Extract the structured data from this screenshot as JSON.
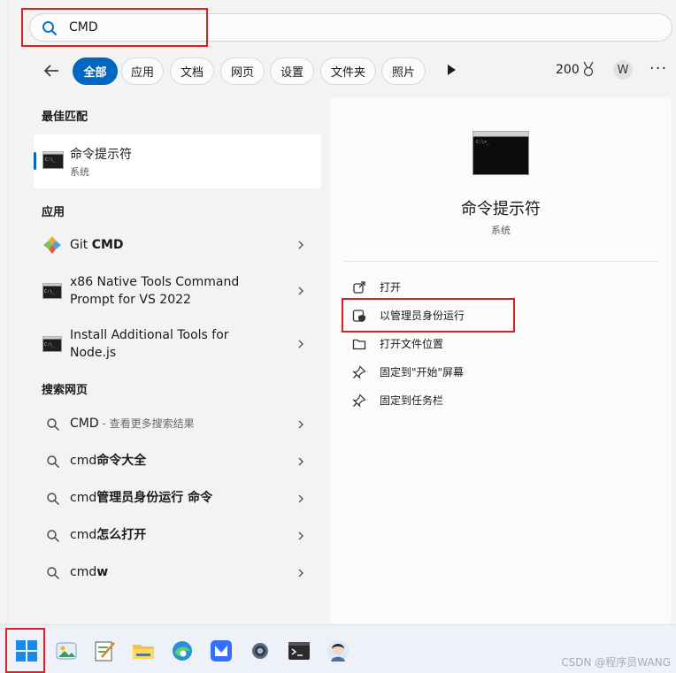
{
  "search": {
    "value": "CMD"
  },
  "filters": {
    "tabs": [
      {
        "label": "全部",
        "active": true
      },
      {
        "label": "应用"
      },
      {
        "label": "文档"
      },
      {
        "label": "网页"
      },
      {
        "label": "设置"
      },
      {
        "label": "文件夹"
      },
      {
        "label": "照片"
      }
    ],
    "points": "200",
    "avatar_initial": "W",
    "more": "···"
  },
  "best_match": {
    "heading": "最佳匹配",
    "name": "命令提示符",
    "sub": "系统",
    "icon": "terminal-icon"
  },
  "apps": {
    "heading": "应用",
    "items": [
      {
        "prefix": "Git ",
        "bold": "CMD",
        "icon": "git-icon"
      },
      {
        "line1": "x86 Native Tools Command",
        "line2": "Prompt for VS 2022",
        "icon": "terminal-icon"
      },
      {
        "line1": "Install Additional Tools for",
        "line2": "Node.js",
        "icon": "terminal-icon"
      }
    ]
  },
  "web": {
    "heading": "搜索网页",
    "items": [
      {
        "main": "CMD",
        "suffix": " - 查看更多搜索结果"
      },
      {
        "main": "cmd",
        "bold": "命令大全"
      },
      {
        "main": "cmd",
        "bold": "管理员身份运行 命令"
      },
      {
        "main": "cmd",
        "bold": "怎么打开"
      },
      {
        "main": "cmd",
        "bold": "w"
      }
    ]
  },
  "detail": {
    "title": "命令提示符",
    "sub": "系统",
    "actions": [
      {
        "label": "打开",
        "icon": "open-external-icon"
      },
      {
        "label": "以管理员身份运行",
        "icon": "shield-icon"
      },
      {
        "label": "打开文件位置",
        "icon": "folder-icon"
      },
      {
        "label": "固定到\"开始\"屏幕",
        "icon": "pin-icon"
      },
      {
        "label": "固定到任务栏",
        "icon": "pin-icon"
      }
    ]
  },
  "taskbar": {
    "icons": [
      "start-icon",
      "photos-icon",
      "notepad-icon",
      "file-explorer-icon",
      "edge-icon",
      "feishu-icon",
      "settings-icon",
      "terminal-icon",
      "avatar-icon"
    ],
    "watermark": "CSDN @程序员WANG"
  },
  "colors": {
    "accent": "#0067c0",
    "highlight": "#e02020"
  }
}
